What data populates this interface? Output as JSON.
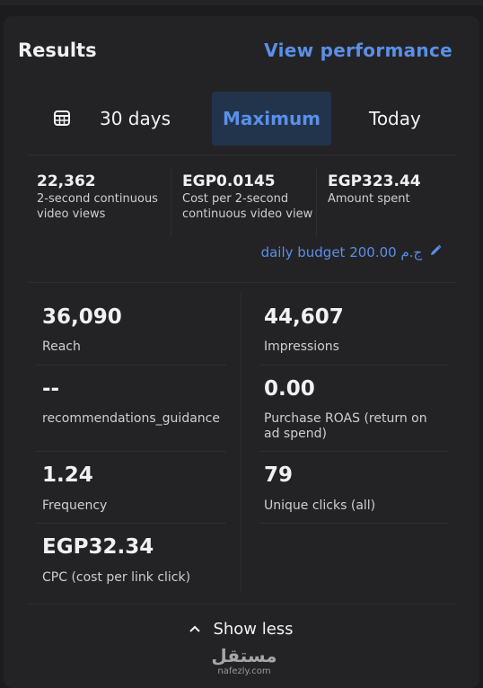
{
  "header": {
    "title": "Results",
    "view_performance": "View performance"
  },
  "date_range": {
    "items": [
      {
        "label": "30 days",
        "icon": "calendar-icon"
      },
      {
        "label": "Maximum",
        "selected": true
      },
      {
        "label": "Today"
      }
    ]
  },
  "summary_metrics": [
    {
      "value": "22,362",
      "label": "2-second continuous video views"
    },
    {
      "value": "EGP0.0145",
      "label": "Cost per 2-second continuous video view"
    },
    {
      "value": "EGP323.44",
      "label": "Amount spent"
    }
  ],
  "budget": {
    "text": "daily budget 200.00 ج.م",
    "icon": "pencil-icon"
  },
  "grid_metrics": [
    {
      "value": "36,090",
      "label": "Reach"
    },
    {
      "value": "44,607",
      "label": "Impressions"
    },
    {
      "value": "--",
      "label": "recommendations_guidance"
    },
    {
      "value": "0.00",
      "label": "Purchase ROAS (return on ad spend)"
    },
    {
      "value": "1.24",
      "label": "Frequency"
    },
    {
      "value": "79",
      "label": "Unique clicks (all)"
    },
    {
      "value": "EGP32.34",
      "label": "CPC (cost per link click)"
    }
  ],
  "footer": {
    "show_less": "Show less",
    "icon": "chevron-up-icon"
  },
  "watermark": {
    "arabic": "مستقل",
    "url": "nafezly.com"
  },
  "colors": {
    "background": "#1c1c1e",
    "card": "#232325",
    "accent": "#5b8fe8",
    "selected_bg": "#22344c",
    "text": "#f1f1f3",
    "muted": "#cfcfd2"
  }
}
